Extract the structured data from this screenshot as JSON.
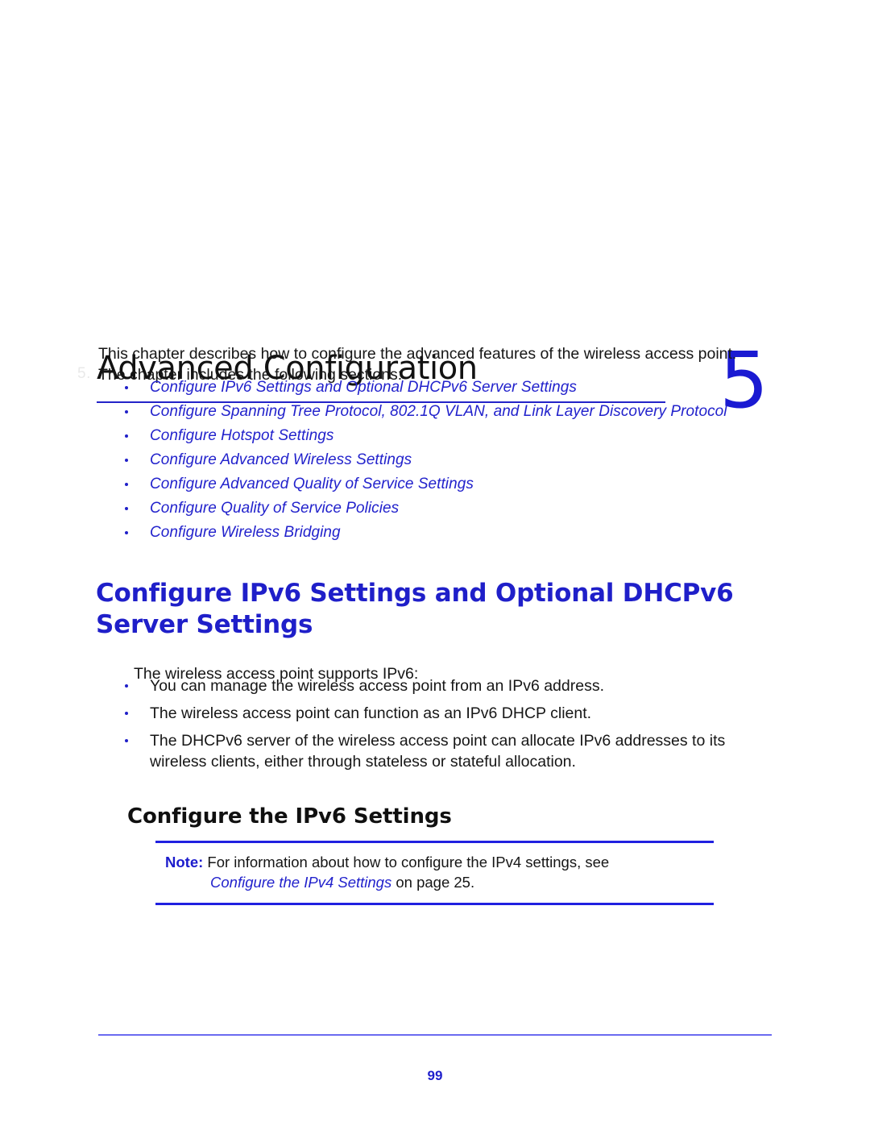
{
  "chapter": {
    "watermark": "5.",
    "title": "Advanced Configuration",
    "number": "5"
  },
  "intro": {
    "paragraph": "This chapter describes how to configure the advanced features of the wireless access point. The chapter includes the following sections:"
  },
  "section_links": [
    {
      "label": "Configure IPv6 Settings and Optional DHCPv6 Server Settings"
    },
    {
      "label": "Configure Spanning Tree Protocol, 802.1Q VLAN, and Link Layer Discovery Protocol"
    },
    {
      "label": "Configure Hotspot Settings"
    },
    {
      "label": "Configure Advanced Wireless Settings"
    },
    {
      "label": "Configure Advanced Quality of Service Settings"
    },
    {
      "label": "Configure Quality of Service Policies"
    },
    {
      "label": "Configure Wireless Bridging"
    }
  ],
  "section": {
    "heading": "Configure IPv6 Settings and Optional DHCPv6 Server Settings",
    "support_line": "The wireless access point supports IPv6:",
    "facts": [
      {
        "text": "You can manage the wireless access point from an IPv6 address."
      },
      {
        "text": "The wireless access point can function as an IPv6 DHCP client."
      },
      {
        "text": "The DHCPv6 server of the wireless access point can allocate IPv6 addresses to its wireless clients, either through stateless or stateful allocation."
      }
    ],
    "sub_heading": "Configure the IPv6 Settings"
  },
  "note": {
    "label": "Note:",
    "line1_text": "For information about how to configure the IPv4 settings, see",
    "xref": "Configure the IPv4 Settings",
    "line2_suffix": "on page 25."
  },
  "footer": {
    "page_number": "99"
  },
  "colors": {
    "brand_blue": "#2222cc",
    "chapter_number_blue": "#1a1ad2",
    "rule_blue": "#2323c8",
    "footer_rule_blue": "#6b6bf0",
    "body_black": "#161616"
  }
}
